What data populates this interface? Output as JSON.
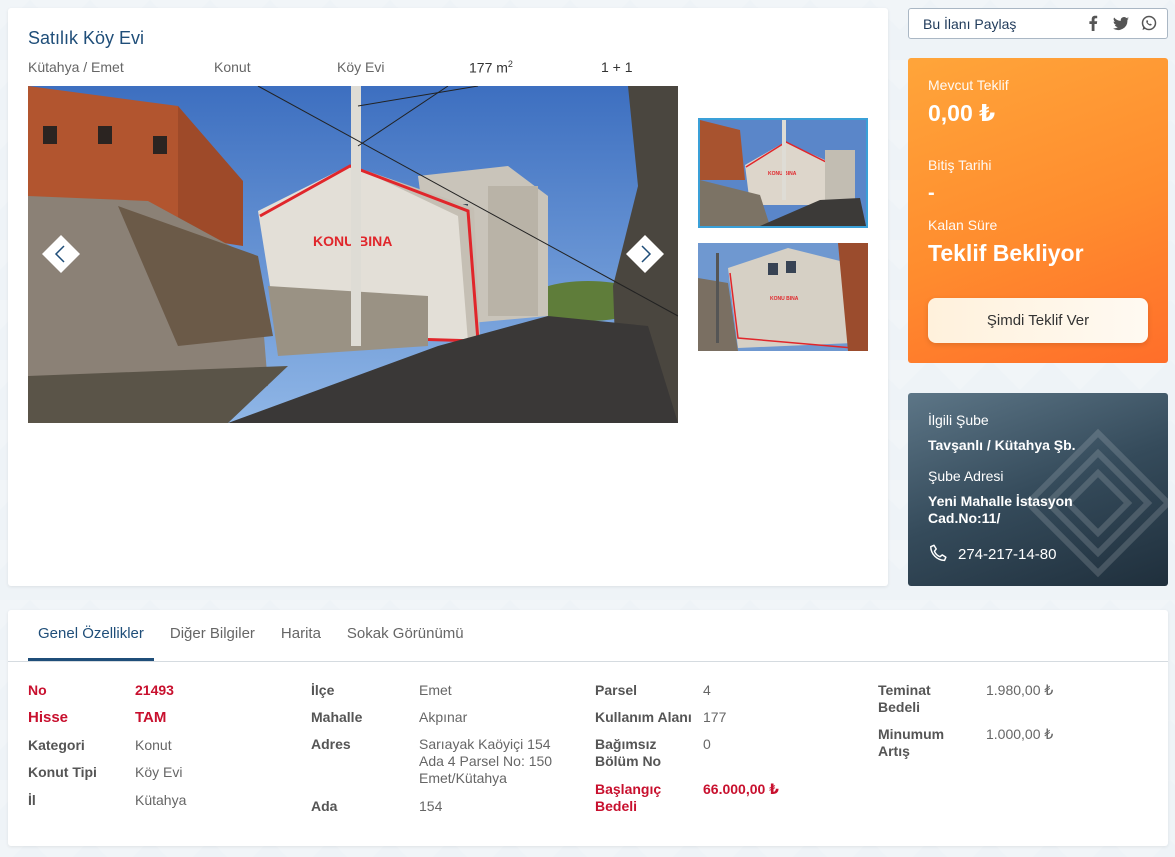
{
  "listing": {
    "title": "Satılık Köy Evi",
    "location": "Kütahya / Emet",
    "type": "Konut",
    "subtype": "Köy Evi",
    "area": "177 m",
    "area_unit_sup": "2",
    "rooms": "1 + 1"
  },
  "images": {
    "main_label": "KONU BINA",
    "thumb1_label": "KONU BINA",
    "thumb2_label": "KONU BINA"
  },
  "share": {
    "label": "Bu İlanı Paylaş",
    "icons": [
      "facebook-icon",
      "twitter-icon",
      "whatsapp-icon"
    ]
  },
  "offer": {
    "current_label": "Mevcut Teklif",
    "current_value": "0,00 ₺",
    "end_label": "Bitiş Tarihi",
    "end_value": "-",
    "remaining_label": "Kalan Süre",
    "remaining_value": "Teklif Bekliyor",
    "button": "Şimdi Teklif Ver"
  },
  "branch": {
    "branch_label": "İlgili Şube",
    "branch_value": "Tavşanlı / Kütahya Şb.",
    "address_label": "Şube Adresi",
    "address_value": "Yeni Mahalle İstasyon Cad.No:11/",
    "phone": "274-217-14-80"
  },
  "tabs": [
    "Genel Özellikler",
    "Diğer Bilgiler",
    "Harita",
    "Sokak Görünümü"
  ],
  "fields": {
    "no_k": "No",
    "no_v": "21493",
    "hisse_k": "Hisse",
    "hisse_v": "TAM",
    "kategori_k": "Kategori",
    "kategori_v": "Konut",
    "konut_tipi_k": "Konut Tipi",
    "konut_tipi_v": "Köy Evi",
    "il_k": "İl",
    "il_v": "Kütahya",
    "ilce_k": "İlçe",
    "ilce_v": "Emet",
    "mahalle_k": "Mahalle",
    "mahalle_v": "Akpınar",
    "adres_k": "Adres",
    "adres_v": "Sarıayak Kaöyiçi 154 Ada 4 Parsel No: 150 Emet/Kütahya",
    "ada_k": "Ada",
    "ada_v": "154",
    "parsel_k": "Parsel",
    "parsel_v": "4",
    "kullanim_k": "Kullanım Alanı",
    "kullanim_v": "177",
    "bagimsiz_k": "Bağımsız Bölüm No",
    "bagimsiz_v": "0",
    "baslangic_k": "Başlangıç Bedeli",
    "baslangic_v": "66.000,00 ₺",
    "teminat_k": "Teminat Bedeli",
    "teminat_v": "1.980,00 ₺",
    "minimum_k": "Minumum Artış",
    "minimum_v": "1.000,00 ₺"
  }
}
